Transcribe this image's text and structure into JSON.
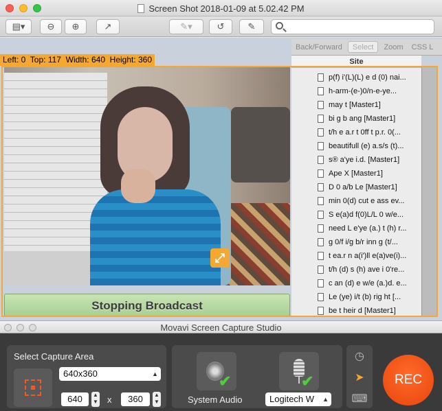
{
  "preview": {
    "title": "Screen Shot 2018-01-09 at 5.02.42 PM",
    "search_placeholder": ""
  },
  "capture": {
    "label": "Left: 0  Top: 117  Width: 640  Height: 360",
    "stop_label": "Stopping Broadcast"
  },
  "inspector": {
    "tabs": [
      "Back/Forward",
      "Select",
      "Zoom",
      "CSS L"
    ],
    "column_header": "Site",
    "rows": [
      "p(f) i'(L)(L) e d (0) nai...",
      "h-arm-(e-)0/n-e-ye...",
      "may t [Master1]",
      "bi g b ang [Master1]",
      "t/h e a.r t 0ff t p.r. 0(...",
      "beautifull (e) a.s/s (t)...",
      "s® a'ye i.d. [Master1]",
      "Ape X [Master1]",
      "D 0 a/b Le [Master1]",
      "min 0(d) cut e ass ev...",
      "S e(a)d f(0)L/L 0 w/e...",
      "need L e'ye (a.) t (h) r...",
      "g 0/f i/g b/r inn g (t/...",
      "t ea.r n a(i')ll e(a)ve(i)...",
      "t/h (d) s (h) ave i 0're...",
      "c an (d) e w/e (a.)d. e...",
      "Le (ye) i/t (b) rig ht  [...",
      "be t heir d [Master1]"
    ]
  },
  "movavi": {
    "title": "Movavi Screen Capture Studio",
    "select_area_label": "Select Capture Area",
    "resolution": "640x360",
    "width": "640",
    "height": "360",
    "times": "x",
    "system_audio_label": "System Audio",
    "mic_device": "Logitech W",
    "rec_label": "REC"
  }
}
